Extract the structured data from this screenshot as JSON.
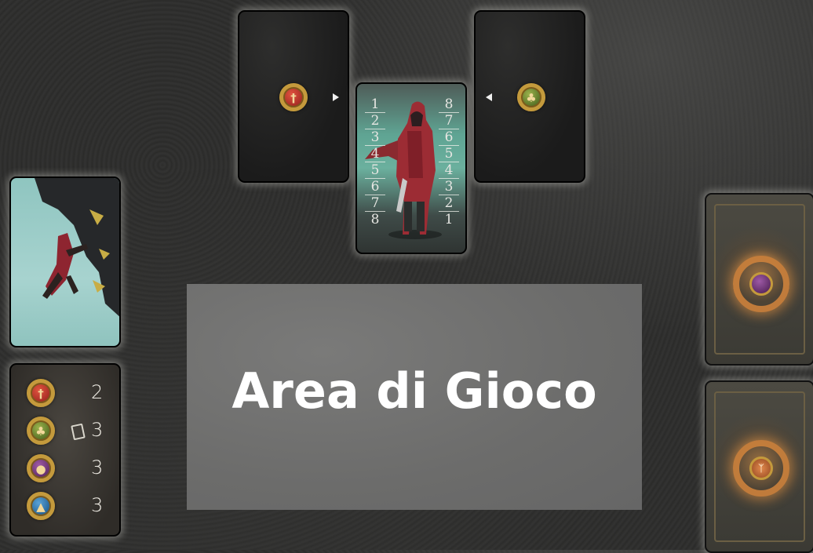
{
  "play_area": {
    "title": "Area di Gioco"
  },
  "top_cards": [
    {
      "id": "left-dark-card",
      "token_color": "red",
      "token_icon": "dagger-icon",
      "arrow": "right"
    },
    {
      "id": "right-dark-card",
      "token_color": "green",
      "token_icon": "leaf-icon",
      "arrow": "left"
    }
  ],
  "character_card": {
    "left_track": [
      "1",
      "2",
      "3",
      "4",
      "5",
      "6",
      "7",
      "8"
    ],
    "right_track": [
      "8",
      "7",
      "6",
      "5",
      "4",
      "3",
      "2",
      "1"
    ]
  },
  "resources": [
    {
      "icon": "dagger-icon",
      "color": "red",
      "value": "2",
      "extra_icon": ""
    },
    {
      "icon": "leaf-icon",
      "color": "green",
      "value": "3",
      "extra_icon": "card-outline-icon"
    },
    {
      "icon": "fist-icon",
      "color": "purple",
      "value": "3",
      "extra_icon": ""
    },
    {
      "icon": "up-arrow-icon",
      "color": "blue",
      "value": "3",
      "extra_icon": ""
    }
  ],
  "location_cards": [
    {
      "id": "location-purple",
      "core_color": "purple"
    },
    {
      "id": "location-runes",
      "core_color": "orange"
    }
  ],
  "colors": {
    "red_token": "#c3382b",
    "green_token": "#6f8c34",
    "purple_token": "#7b3d84",
    "blue_token": "#2f7ab5",
    "gold_ring": "#c49a3c",
    "play_area": "#6f6f6e"
  }
}
